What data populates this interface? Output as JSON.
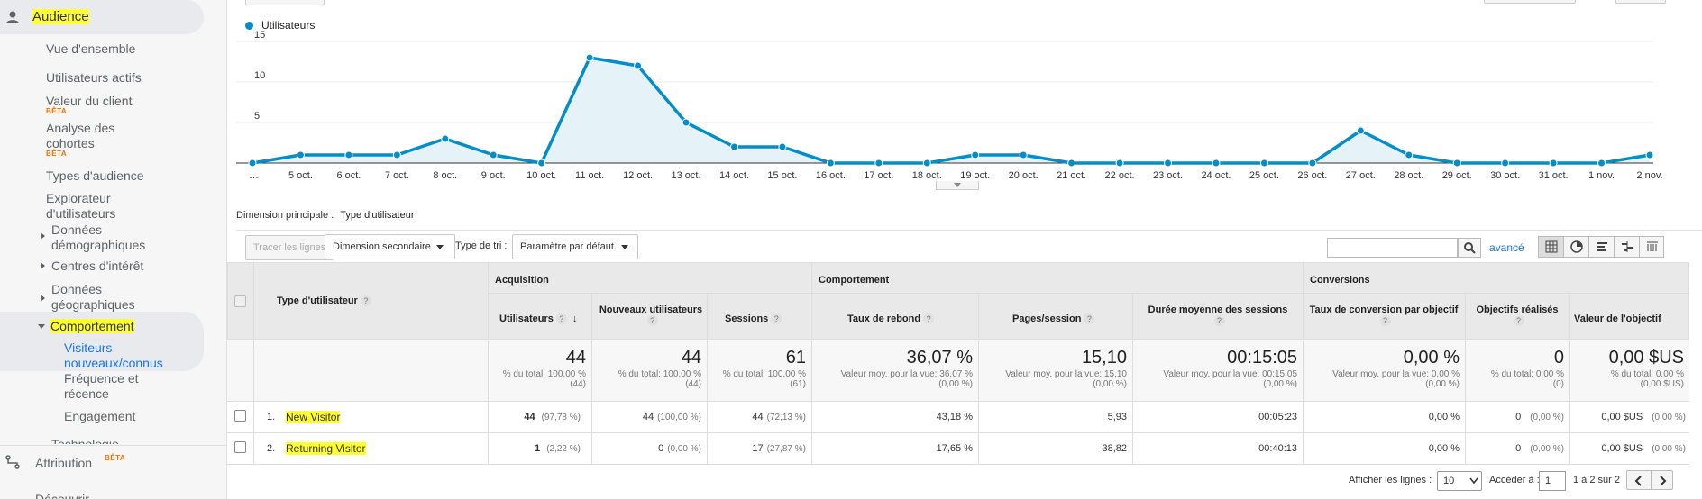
{
  "sidebar": {
    "audience": "Audience",
    "items": [
      {
        "label": "Vue d'ensemble"
      },
      {
        "label": "Utilisateurs actifs"
      },
      {
        "label": "Valeur du client",
        "badge": "BÊTA"
      },
      {
        "label": "Analyse des cohortes",
        "badge": "BÊTA"
      },
      {
        "label": "Types d'audience"
      },
      {
        "label": "Explorateur d'utilisateurs"
      },
      {
        "label": "Données démographiques"
      },
      {
        "label": "Centres d'intérêt"
      },
      {
        "label": "Données géographiques"
      },
      {
        "label": "Comportement"
      },
      {
        "label": "Visiteurs nouveaux/connus"
      },
      {
        "label": "Fréquence et récence"
      },
      {
        "label": "Engagement"
      },
      {
        "label": "Technologie"
      }
    ],
    "attribution": "Attribution",
    "attribution_badge": "BÊTA",
    "discover": "Découvrir"
  },
  "chart_data": {
    "type": "area",
    "series": [
      {
        "name": "Utilisateurs",
        "values": [
          0,
          1,
          1,
          1,
          3,
          1,
          0,
          13,
          12,
          5,
          2,
          2,
          0,
          0,
          0,
          1,
          1,
          0,
          0,
          0,
          0,
          0,
          0,
          4,
          1,
          0,
          0,
          0,
          0,
          1
        ]
      }
    ],
    "categories": [
      "…",
      "5 oct.",
      "6 oct.",
      "7 oct.",
      "8 oct.",
      "9 oct.",
      "10 oct.",
      "11 oct.",
      "12 oct.",
      "13 oct.",
      "14 oct.",
      "15 oct.",
      "16 oct.",
      "17 oct.",
      "18 oct.",
      "19 oct.",
      "20 oct.",
      "21 oct.",
      "22 oct.",
      "23 oct.",
      "24 oct.",
      "25 oct.",
      "26 oct.",
      "27 oct.",
      "28 oct.",
      "29 oct.",
      "30 oct.",
      "31 oct.",
      "1 nov.",
      "2 nov."
    ],
    "yticks": [
      "15",
      "10",
      "5"
    ],
    "ylim": [
      0,
      15
    ],
    "color": "#058dc7",
    "fill": "#e5f2f8",
    "grid": true
  },
  "dimension": {
    "label": "Dimension principale :",
    "value": "Type d'utilisateur"
  },
  "toolbar": {
    "plot_rows": "Tracer les lignes",
    "secondary_dim": "Dimension secondaire",
    "sort_label": "Type de tri :",
    "sort_value": "Paramètre par défaut",
    "advanced": "avancé"
  },
  "table": {
    "col_type": "Type d'utilisateur",
    "groups": [
      "Acquisition",
      "Comportement",
      "Conversions"
    ],
    "columns": [
      "Utilisateurs",
      "Nouveaux utilisateurs",
      "Sessions",
      "Taux de rebond",
      "Pages/session",
      "Durée moyenne des sessions",
      "Taux de conversion par objectif",
      "Objectifs réalisés",
      "Valeur de l'objectif"
    ],
    "totals": [
      {
        "big": "44",
        "sub1": "% du total: 100,00 %",
        "sub2": "(44)"
      },
      {
        "big": "44",
        "sub1": "% du total: 100,00 %",
        "sub2": "(44)"
      },
      {
        "big": "61",
        "sub1": "% du total: 100,00 %",
        "sub2": "(61)"
      },
      {
        "big": "36,07 %",
        "sub1": "Valeur moy. pour la vue: 36,07 %",
        "sub2": "(0,00 %)"
      },
      {
        "big": "15,10",
        "sub1": "Valeur moy. pour la vue: 15,10",
        "sub2": "(0,00 %)"
      },
      {
        "big": "00:15:05",
        "sub1": "Valeur moy. pour la vue: 00:15:05",
        "sub2": "(0,00 %)"
      },
      {
        "big": "0,00 %",
        "sub1": "Valeur moy. pour la vue: 0,00 %",
        "sub2": "(0,00 %)"
      },
      {
        "big": "0",
        "sub1": "% du total: 0,00 %",
        "sub2": "(0)"
      },
      {
        "big": "0,00 $US",
        "sub1": "% du total: 0,00 %",
        "sub2": "(0,00 $US)"
      }
    ],
    "rows": [
      {
        "num": "1.",
        "name": "New Visitor",
        "users": "44",
        "users_pct": "(97,78 %)",
        "new": "44",
        "new_pct": "(100,00 %)",
        "sessions": "44",
        "sessions_pct": "(72,13 %)",
        "bounce": "43,18 %",
        "pages": "5,93",
        "duration": "00:05:23",
        "conv": "0,00 %",
        "goals": "0",
        "goals_pct": "(0,00 %)",
        "value": "0,00 $US",
        "value_pct": "(0,00 %)"
      },
      {
        "num": "2.",
        "name": "Returning Visitor",
        "users": "1",
        "users_pct": "(2,22 %)",
        "new": "0",
        "new_pct": "(0,00 %)",
        "sessions": "17",
        "sessions_pct": "(27,87 %)",
        "bounce": "17,65 %",
        "pages": "38,82",
        "duration": "00:40:13",
        "conv": "0,00 %",
        "goals": "0",
        "goals_pct": "(0,00 %)",
        "value": "0,00 $US",
        "value_pct": "(0,00 %)"
      }
    ]
  },
  "pagination": {
    "show_rows": "Afficher les lignes :",
    "rows_value": "10",
    "goto": "Accéder à :",
    "goto_value": "1",
    "range": "1 à 2 sur 2"
  }
}
